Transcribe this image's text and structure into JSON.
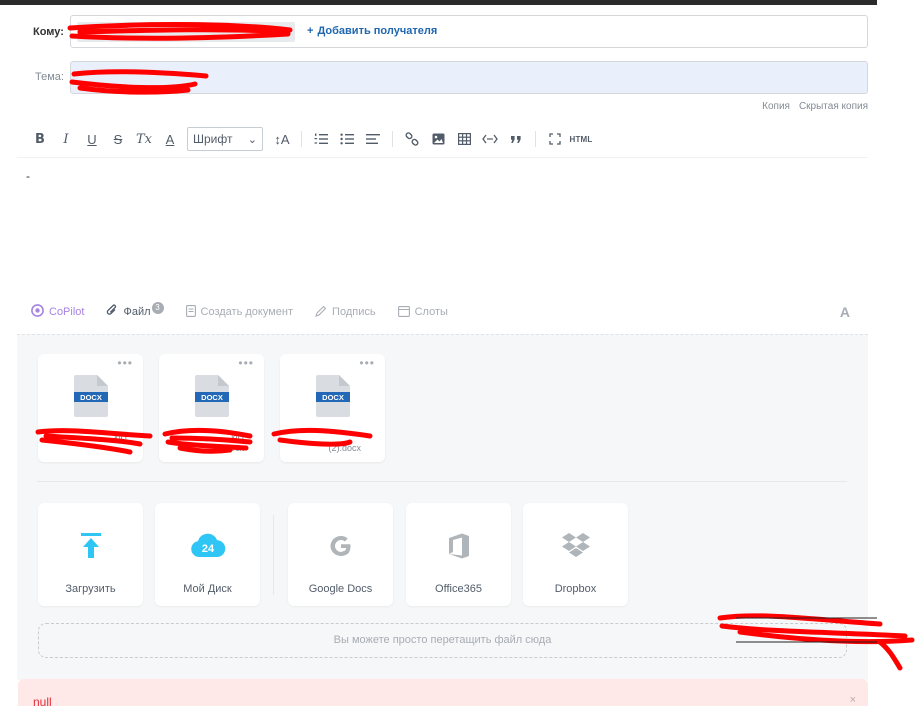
{
  "header": {
    "to_label": "Кому:",
    "subject_label": "Тема:",
    "add_recipient": "Добавить получателя",
    "add_recipient_plus": "+",
    "subject_value": "",
    "cc_label": "Копия",
    "bcc_label": "Скрытая копия"
  },
  "toolbar": {
    "bold": "B",
    "italic": "I",
    "underline": "U",
    "strike": "S",
    "clear_format": "Tx",
    "font_color": "A",
    "font_select": "Шрифт",
    "font_size": "↕A",
    "html": "HTML"
  },
  "editor": {
    "body_text": "-"
  },
  "actions": {
    "copilot": "CoPilot",
    "file": "Файл",
    "file_count": "3",
    "create_doc": "Создать документ",
    "signature": "Подпись",
    "slots": "Слоты",
    "font_toggle": "A"
  },
  "attachments": {
    "more": "•••",
    "files": [
      {
        "ext": "DOCX",
        "name": "ИП"
      },
      {
        "ext": "DOCX",
        "name": "ИП\n(2).docx"
      },
      {
        "ext": "DOCX",
        "name": "(2).docx"
      }
    ]
  },
  "sources": {
    "upload": "Загрузить",
    "my_disk": "Мой Диск",
    "my_disk_badge": "24",
    "google_docs": "Google Docs",
    "office365": "Office365",
    "dropbox": "Dropbox"
  },
  "dropzone": {
    "text": "Вы можете просто перетащить файл сюда"
  },
  "error": {
    "text": "null",
    "close": "×"
  },
  "colors": {
    "accent_blue": "#2067b0",
    "copilot_purple": "#a784e0",
    "upload_teal": "#2fc6f6",
    "error_red": "#e0303b",
    "redaction_red": "#ff0000"
  }
}
